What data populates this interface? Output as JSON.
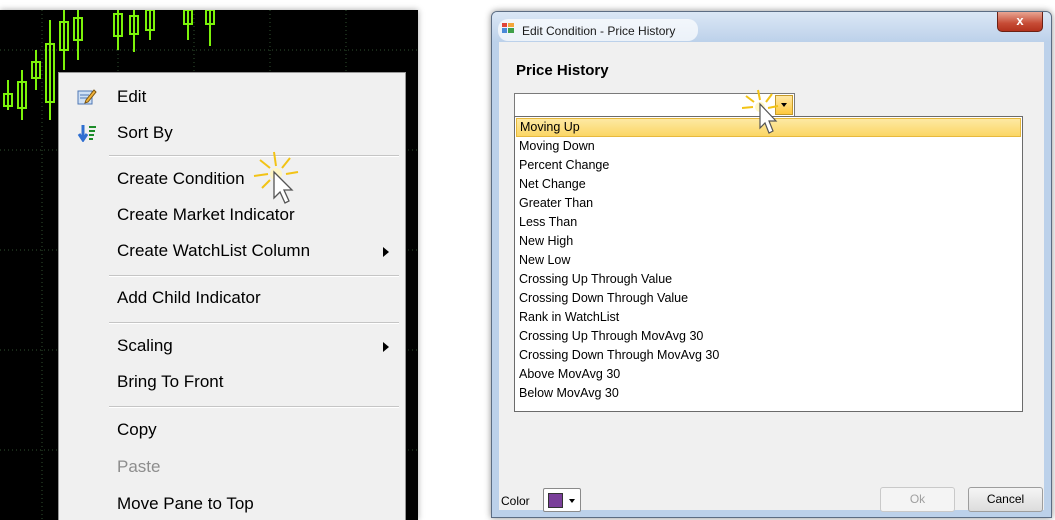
{
  "context_menu": {
    "items": [
      {
        "label": "Edit",
        "icon": "edit-icon"
      },
      {
        "label": "Sort By",
        "icon": "sort-icon"
      },
      {
        "label": "Create Condition"
      },
      {
        "label": "Create Market Indicator"
      },
      {
        "label": "Create WatchList Column",
        "submenu": true
      },
      {
        "label": "Add Child Indicator"
      },
      {
        "label": "Scaling",
        "submenu": true
      },
      {
        "label": "Bring To Front"
      },
      {
        "label": "Copy"
      },
      {
        "label": "Paste",
        "disabled": true
      },
      {
        "label": "Move Pane to Top"
      }
    ]
  },
  "dialog": {
    "title": "Edit Condition - Price History",
    "close_label": "x",
    "heading": "Price History",
    "combo_value": "",
    "options": [
      "Moving Up",
      "Moving Down",
      "Percent Change",
      "Net Change",
      "Greater Than",
      "Less Than",
      "New High",
      "New Low",
      "Crossing Up Through Value",
      "Crossing Down Through Value",
      "Rank in WatchList",
      "Crossing Up Through MovAvg 30",
      "Crossing Down Through MovAvg 30",
      "Above MovAvg 30",
      "Below MovAvg 30"
    ],
    "selected_option": "Moving Up",
    "color_label": "Color",
    "color_value": "#7a3f9a",
    "ok_label": "Ok",
    "cancel_label": "Cancel"
  },
  "colors": {
    "chart_background": "#000000",
    "candle_green": "#7cf20a",
    "selection_yellow": "#fbd665"
  }
}
